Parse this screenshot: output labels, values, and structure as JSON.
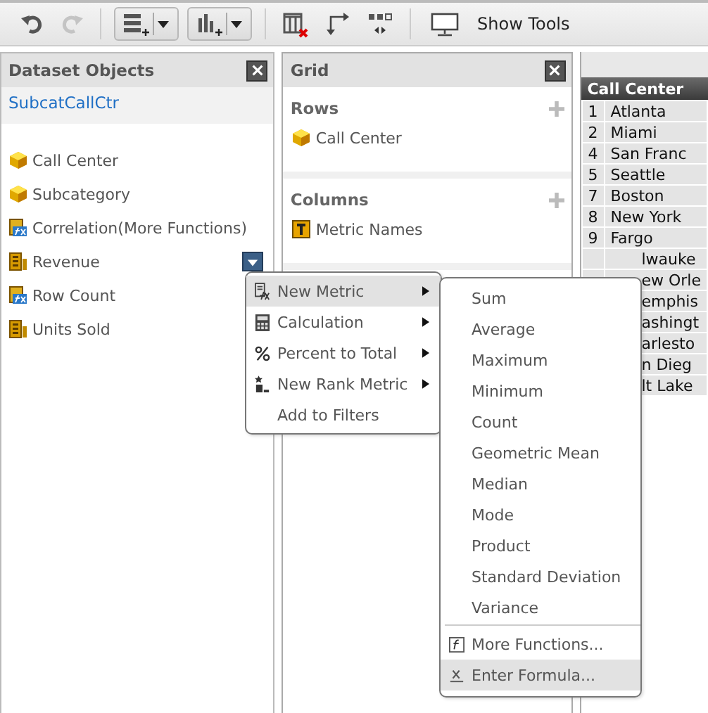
{
  "toolbar": {
    "groups": [
      {
        "items": [
          {
            "kind": "undo",
            "disabled": false
          },
          {
            "kind": "redo",
            "disabled": true
          }
        ]
      },
      {
        "items": [
          {
            "kind": "rows-dropdown"
          },
          {
            "kind": "chart-dropdown"
          }
        ]
      },
      {
        "items": [
          {
            "kind": "clear-grid"
          },
          {
            "kind": "swap"
          },
          {
            "kind": "layout"
          }
        ]
      },
      {
        "items": [
          {
            "kind": "show-tools",
            "label": "Show Tools"
          }
        ]
      }
    ]
  },
  "dataset_objects": {
    "title": "Dataset Objects",
    "dataset": "SubcatCallCtr",
    "items": [
      {
        "label": "Call Center",
        "kind": "attribute",
        "menu_button": false
      },
      {
        "label": "Subcategory",
        "kind": "attribute",
        "menu_button": false
      },
      {
        "label": "Correlation(More Functions)",
        "kind": "derived",
        "menu_button": false
      },
      {
        "label": "Revenue",
        "kind": "metric",
        "menu_button": true
      },
      {
        "label": "Row Count",
        "kind": "derived",
        "menu_button": false
      },
      {
        "label": "Units Sold",
        "kind": "metric",
        "menu_button": false
      }
    ]
  },
  "grid_panel": {
    "title": "Grid",
    "sections": [
      {
        "title": "Rows",
        "items": [
          {
            "label": "Call Center",
            "kind": "attribute"
          }
        ]
      },
      {
        "title": "Columns",
        "items": [
          {
            "label": "Metric Names",
            "kind": "text"
          }
        ]
      }
    ]
  },
  "report": {
    "header": "Call Center",
    "rows": [
      {
        "id": "1",
        "name": "Atlanta"
      },
      {
        "id": "2",
        "name": "Miami"
      },
      {
        "id": "4",
        "name": "San Franc"
      },
      {
        "id": "5",
        "name": "Seattle"
      },
      {
        "id": "7",
        "name": "Boston"
      },
      {
        "id": "8",
        "name": "New York"
      },
      {
        "id": "9",
        "name": "Fargo"
      },
      {
        "name": "lwauke"
      },
      {
        "name": "ew Orle"
      },
      {
        "name": "emphis"
      },
      {
        "name": "ashingt"
      },
      {
        "name": "arlesto"
      },
      {
        "name": "n Dieg"
      },
      {
        "name": "lt Lake"
      }
    ]
  },
  "context_menu": {
    "items": [
      {
        "label": "New Metric",
        "kind": "metric",
        "submenu": true,
        "selected": true
      },
      {
        "label": "Calculation",
        "kind": "calculation",
        "submenu": true,
        "selected": false
      },
      {
        "label": "Percent to Total",
        "kind": "percent",
        "submenu": true,
        "selected": false
      },
      {
        "label": "New Rank Metric",
        "kind": "rank",
        "submenu": true,
        "selected": false
      },
      {
        "label": "Add to Filters",
        "kind": "plain",
        "submenu": false,
        "selected": false
      }
    ]
  },
  "submenu": {
    "groups": [
      {
        "items": [
          {
            "label": "Sum",
            "kind": "plain",
            "selected": false
          },
          {
            "label": "Average",
            "kind": "plain",
            "selected": false
          },
          {
            "label": "Maximum",
            "kind": "plain",
            "selected": false
          },
          {
            "label": "Minimum",
            "kind": "plain",
            "selected": false
          },
          {
            "label": "Count",
            "kind": "plain",
            "selected": false
          },
          {
            "label": "Geometric Mean",
            "kind": "plain",
            "selected": false
          },
          {
            "label": "Median",
            "kind": "plain",
            "selected": false
          },
          {
            "label": "Mode",
            "kind": "plain",
            "selected": false
          },
          {
            "label": "Product",
            "kind": "plain",
            "selected": false
          },
          {
            "label": "Standard Deviation",
            "kind": "plain",
            "selected": false
          },
          {
            "label": "Variance",
            "kind": "plain",
            "selected": false
          }
        ]
      },
      {
        "items": [
          {
            "label": "More Functions...",
            "kind": "function",
            "selected": false
          },
          {
            "label": "Enter Formula...",
            "kind": "formula",
            "selected": true
          }
        ]
      }
    ]
  }
}
